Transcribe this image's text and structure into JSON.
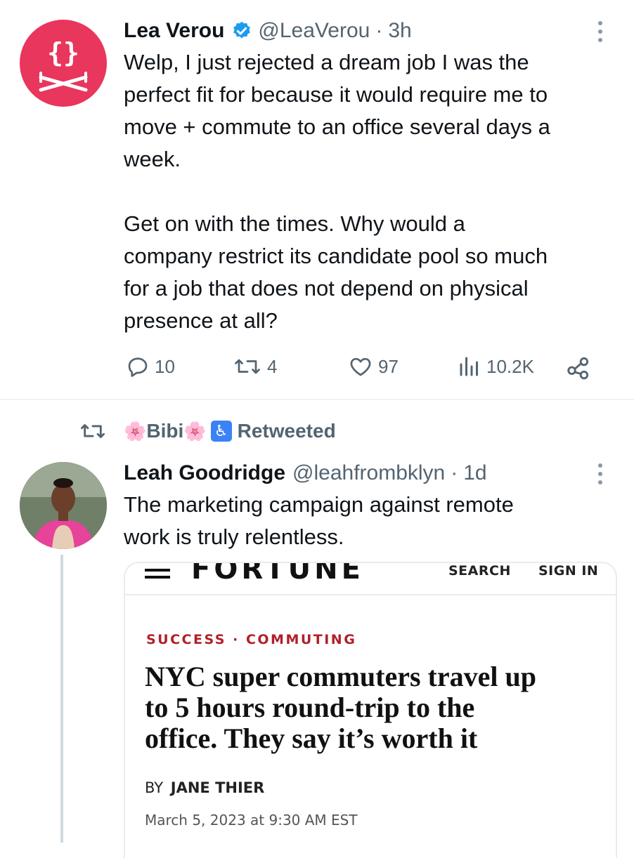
{
  "tweet1": {
    "author_name": "Lea Verou",
    "handle": "@LeaVerou",
    "separator": "·",
    "time": "3h",
    "avatar_glyph": "{}",
    "verified_icon": "verified-badge-icon",
    "text": "Welp, I just rejected a dream job I was the\nperfect fit for because it would require me to\nmove + commute to an office several days a\nweek.\n\nGet on with the times. Why would a\ncompany restrict its candidate pool so much\nfor a job that does not depend on physical\npresence at all?",
    "replies": "10",
    "retweets": "4",
    "likes": "97",
    "views": "10.2K"
  },
  "retweet_context": {
    "label_name": "Bibi",
    "label_suffix": "Retweeted",
    "emoji_left": "🌸",
    "emoji_right": "🌸",
    "accessibility_emoji": "♿"
  },
  "tweet2": {
    "author_name": "Leah Goodridge",
    "handle": "@leahfrombklyn",
    "separator": "·",
    "time": "1d",
    "text": "The marketing campaign against remote\nwork is truly relentless."
  },
  "article": {
    "masthead": "FORTUNE",
    "menu_icon": "=",
    "search": "SEARCH",
    "sign_in": "SIGN IN",
    "category": "SUCCESS · COMMUTING",
    "headline": "NYC super commuters travel up\nto 5 hours round-trip to the\noffice. They say it’s worth it",
    "byline_prefix": "BY",
    "byline_name": "JANE THIER",
    "date": "March 5, 2023 at 9:30 AM EST"
  },
  "colors": {
    "accent_red": "#e8365d",
    "verified_blue": "#1d9bf0",
    "muted": "#536471",
    "category_red": "#b1202a"
  }
}
